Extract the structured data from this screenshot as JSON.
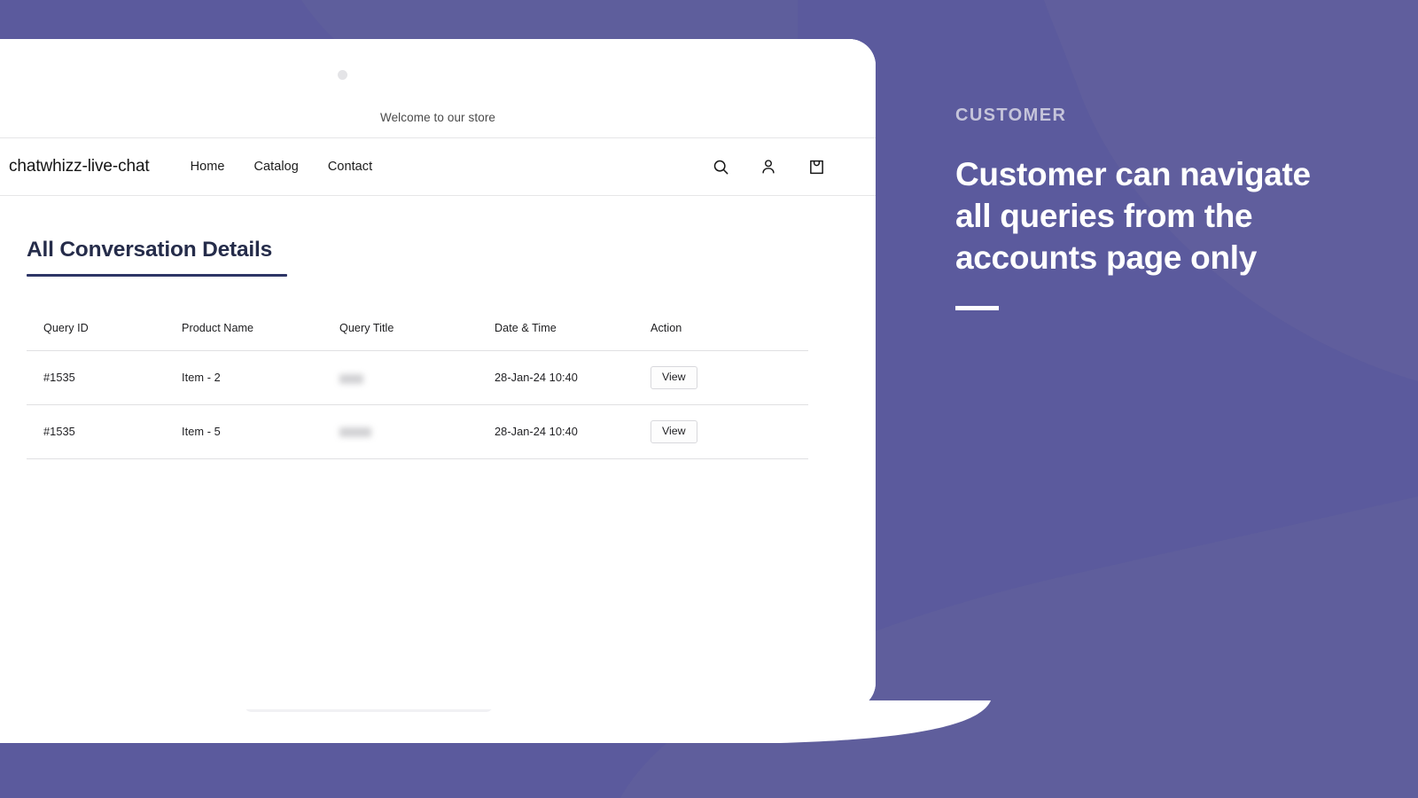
{
  "theme": {
    "purple_bg": "#5b5a9d",
    "purple_blob_light": "#64639c",
    "navy_accent": "#2d3566",
    "heading_color": "#252c4a",
    "eyebrow_color": "#c5c4da",
    "card_bg": "#ffffff"
  },
  "storefront": {
    "announcement": {
      "text": "Welcome to our store",
      "dot_icon": "status-dot-icon"
    },
    "nav": {
      "brand": "chatwhizz-live-chat",
      "links": [
        {
          "label": "Home"
        },
        {
          "label": "Catalog"
        },
        {
          "label": "Contact"
        }
      ],
      "actions": [
        {
          "icon": "search-icon",
          "label": "Search"
        },
        {
          "icon": "account-icon",
          "label": "Account"
        },
        {
          "icon": "cart-icon",
          "label": "Cart"
        }
      ]
    },
    "page": {
      "title": "All Conversation Details",
      "table": {
        "columns": [
          "Query ID",
          "Product Name",
          "Query Title",
          "Date & Time",
          "Action"
        ],
        "rows": [
          {
            "query_id": "#1535",
            "product_name": "Item - 2",
            "query_title": "",
            "query_title_redacted": true,
            "date_time": "28-Jan-24 10:40",
            "action_label": "View"
          },
          {
            "query_id": "#1535",
            "product_name": "Item - 5",
            "query_title": "",
            "query_title_redacted": true,
            "date_time": "28-Jan-24 10:40",
            "action_label": "View"
          }
        ]
      }
    }
  },
  "promo": {
    "eyebrow": "CUSTOMER",
    "headline": "Customer can navigate all queries from the accounts page only"
  }
}
